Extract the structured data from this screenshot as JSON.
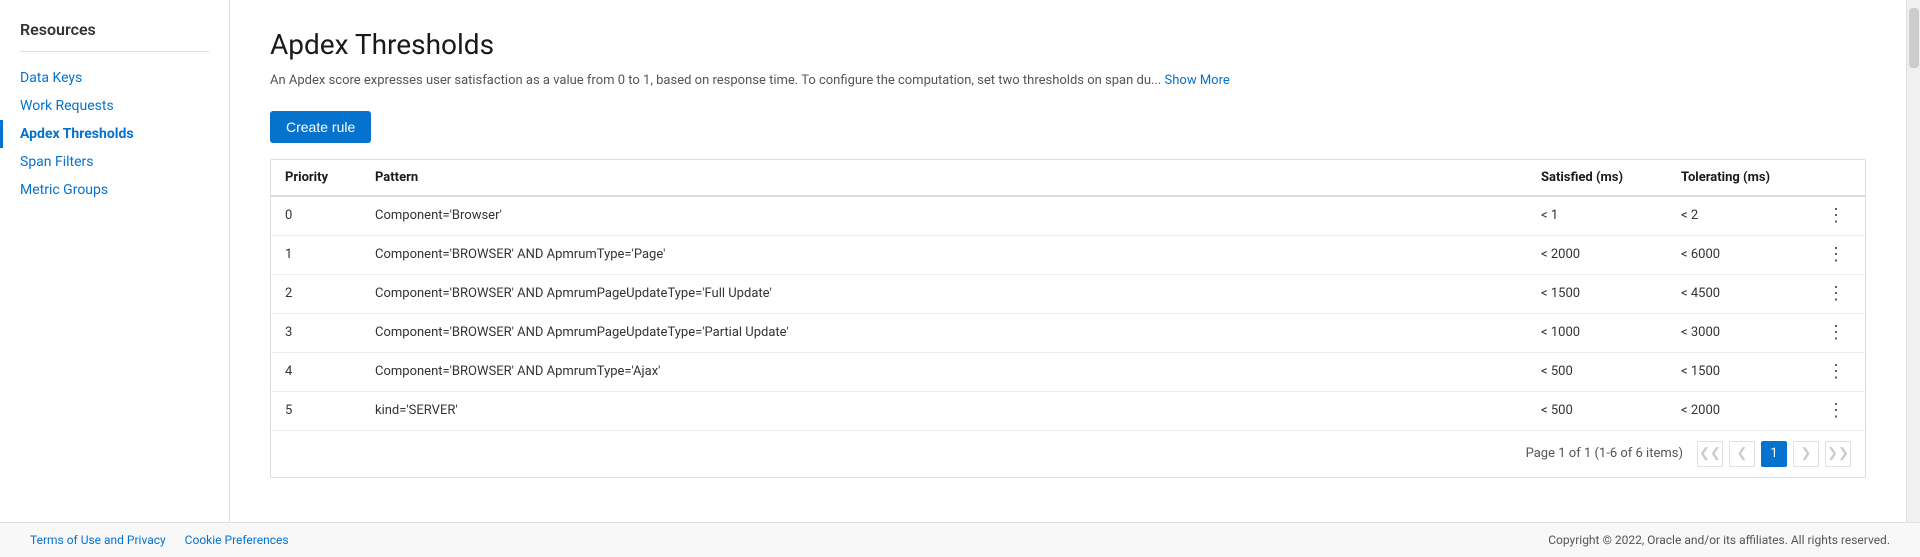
{
  "sidebar": {
    "title": "Resources",
    "items": [
      {
        "label": "Data Keys",
        "active": false,
        "id": "data-keys"
      },
      {
        "label": "Work Requests",
        "active": false,
        "id": "work-requests"
      },
      {
        "label": "Apdex Thresholds",
        "active": true,
        "id": "apdex-thresholds"
      },
      {
        "label": "Span Filters",
        "active": false,
        "id": "span-filters"
      },
      {
        "label": "Metric Groups",
        "active": false,
        "id": "metric-groups"
      }
    ]
  },
  "main": {
    "title": "Apdex Thresholds",
    "description": "An Apdex score expresses user satisfaction as a value from 0 to 1, based on response time. To configure the computation, set two thresholds on span du...",
    "show_more_label": "Show More",
    "create_rule_label": "Create rule",
    "table": {
      "columns": [
        "Priority",
        "Pattern",
        "Satisfied (ms)",
        "Tolerating (ms)",
        ""
      ],
      "rows": [
        {
          "priority": "0",
          "pattern": "Component='Browser'",
          "satisfied": "< 1",
          "tolerating": "< 2"
        },
        {
          "priority": "1",
          "pattern": "Component='BROWSER' AND ApmrumType='Page'",
          "satisfied": "< 2000",
          "tolerating": "< 6000"
        },
        {
          "priority": "2",
          "pattern": "Component='BROWSER' AND ApmrumPageUpdateType='Full Update'",
          "satisfied": "< 1500",
          "tolerating": "< 4500"
        },
        {
          "priority": "3",
          "pattern": "Component='BROWSER' AND ApmrumPageUpdateType='Partial Update'",
          "satisfied": "< 1000",
          "tolerating": "< 3000"
        },
        {
          "priority": "4",
          "pattern": "Component='BROWSER' AND ApmrumType='Ajax'",
          "satisfied": "< 500",
          "tolerating": "< 1500"
        },
        {
          "priority": "5",
          "pattern": "kind='SERVER'",
          "satisfied": "< 500",
          "tolerating": "< 2000"
        }
      ]
    },
    "pagination": {
      "page_label": "Page",
      "page_num": "1",
      "of_label": "of",
      "total_pages": "1",
      "items_info": "(1-6 of 6 items)",
      "current_page": "1"
    }
  },
  "footer": {
    "terms_label": "Terms of Use and Privacy",
    "cookie_label": "Cookie Preferences",
    "copyright": "Copyright © 2022, Oracle and/or its affiliates. All rights reserved."
  }
}
